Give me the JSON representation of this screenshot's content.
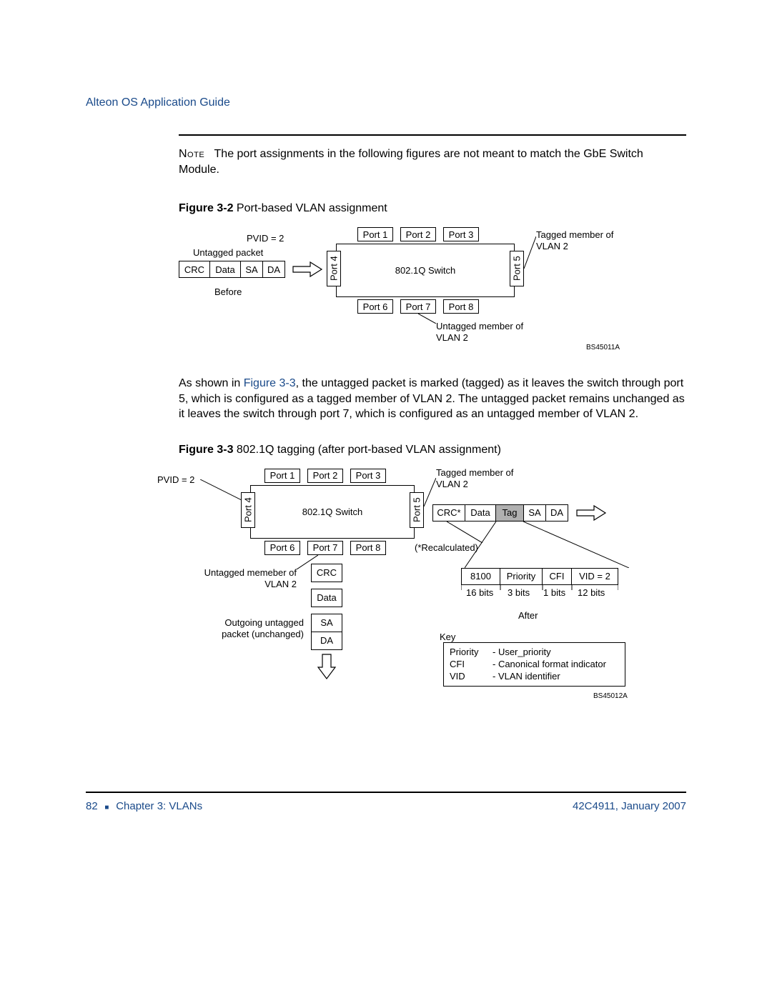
{
  "header": {
    "title": "Alteon OS Application Guide"
  },
  "note": {
    "label": "Note",
    "text": "The port assignments in the following figures are not meant to match the GbE Switch Module."
  },
  "fig32": {
    "num": "Figure 3-2",
    "title": "Port-based VLAN assignment",
    "pvid": "PVID = 2",
    "untagged_packet": "Untagged packet",
    "packet": {
      "crc": "CRC",
      "data": "Data",
      "sa": "SA",
      "da": "DA"
    },
    "before": "Before",
    "ports": {
      "p1": "Port 1",
      "p2": "Port 2",
      "p3": "Port 3",
      "p4": "Port 4",
      "p5": "Port 5",
      "p6": "Port 6",
      "p7": "Port 7",
      "p8": "Port 8"
    },
    "switch": "802.1Q Switch",
    "tagged_member": "Tagged member of VLAN 2",
    "untagged_member": "Untagged member of VLAN 2",
    "code": "BS45011A"
  },
  "para1": {
    "prefix": "As shown in ",
    "link": "Figure 3-3",
    "rest": ", the untagged packet is marked (tagged) as it leaves the switch through port 5, which is configured as a tagged member of VLAN 2. The untagged packet remains unchanged as it leaves the switch through port 7, which is configured as an untagged member of VLAN 2."
  },
  "fig33": {
    "num": "Figure 3-3",
    "title": "802.1Q tagging (after port-based VLAN assignment)",
    "pvid": "PVID = 2",
    "ports": {
      "p1": "Port 1",
      "p2": "Port 2",
      "p3": "Port 3",
      "p4": "Port 4",
      "p5": "Port 5",
      "p6": "Port 6",
      "p7": "Port 7",
      "p8": "Port 8"
    },
    "switch": "802.1Q Switch",
    "tagged_member": "Tagged member of VLAN 2",
    "recalc": "(*Recalculated)",
    "tagged_packet": {
      "crc": "CRC*",
      "data": "Data",
      "tag": "Tag",
      "sa": "SA",
      "da": "DA"
    },
    "tag_fields": {
      "tpid": "8100",
      "priority": "Priority",
      "cfi": "CFI",
      "vid": "VID = 2"
    },
    "bits": {
      "b16": "16 bits",
      "b3": "3 bits",
      "b1": "1 bits",
      "b12": "12 bits"
    },
    "after": "After",
    "untagged_memeber": "Untagged memeber of VLAN 2",
    "outgoing": "Outgoing untagged packet (unchanged)",
    "vertical_packet": {
      "crc": "CRC",
      "data": "Data",
      "sa": "SA",
      "da": "DA"
    },
    "key_label": "Key",
    "key": {
      "priority": {
        "k": "Priority",
        "v": "- User_priority"
      },
      "cfi": {
        "k": "CFI",
        "v": "- Canonical format indicator"
      },
      "vid": {
        "k": "VID",
        "v": "- VLAN identifier"
      }
    },
    "code": "BS45012A"
  },
  "footer": {
    "page": "82",
    "chapter": "Chapter 3: VLANs",
    "doc": "42C4911, January 2007"
  }
}
